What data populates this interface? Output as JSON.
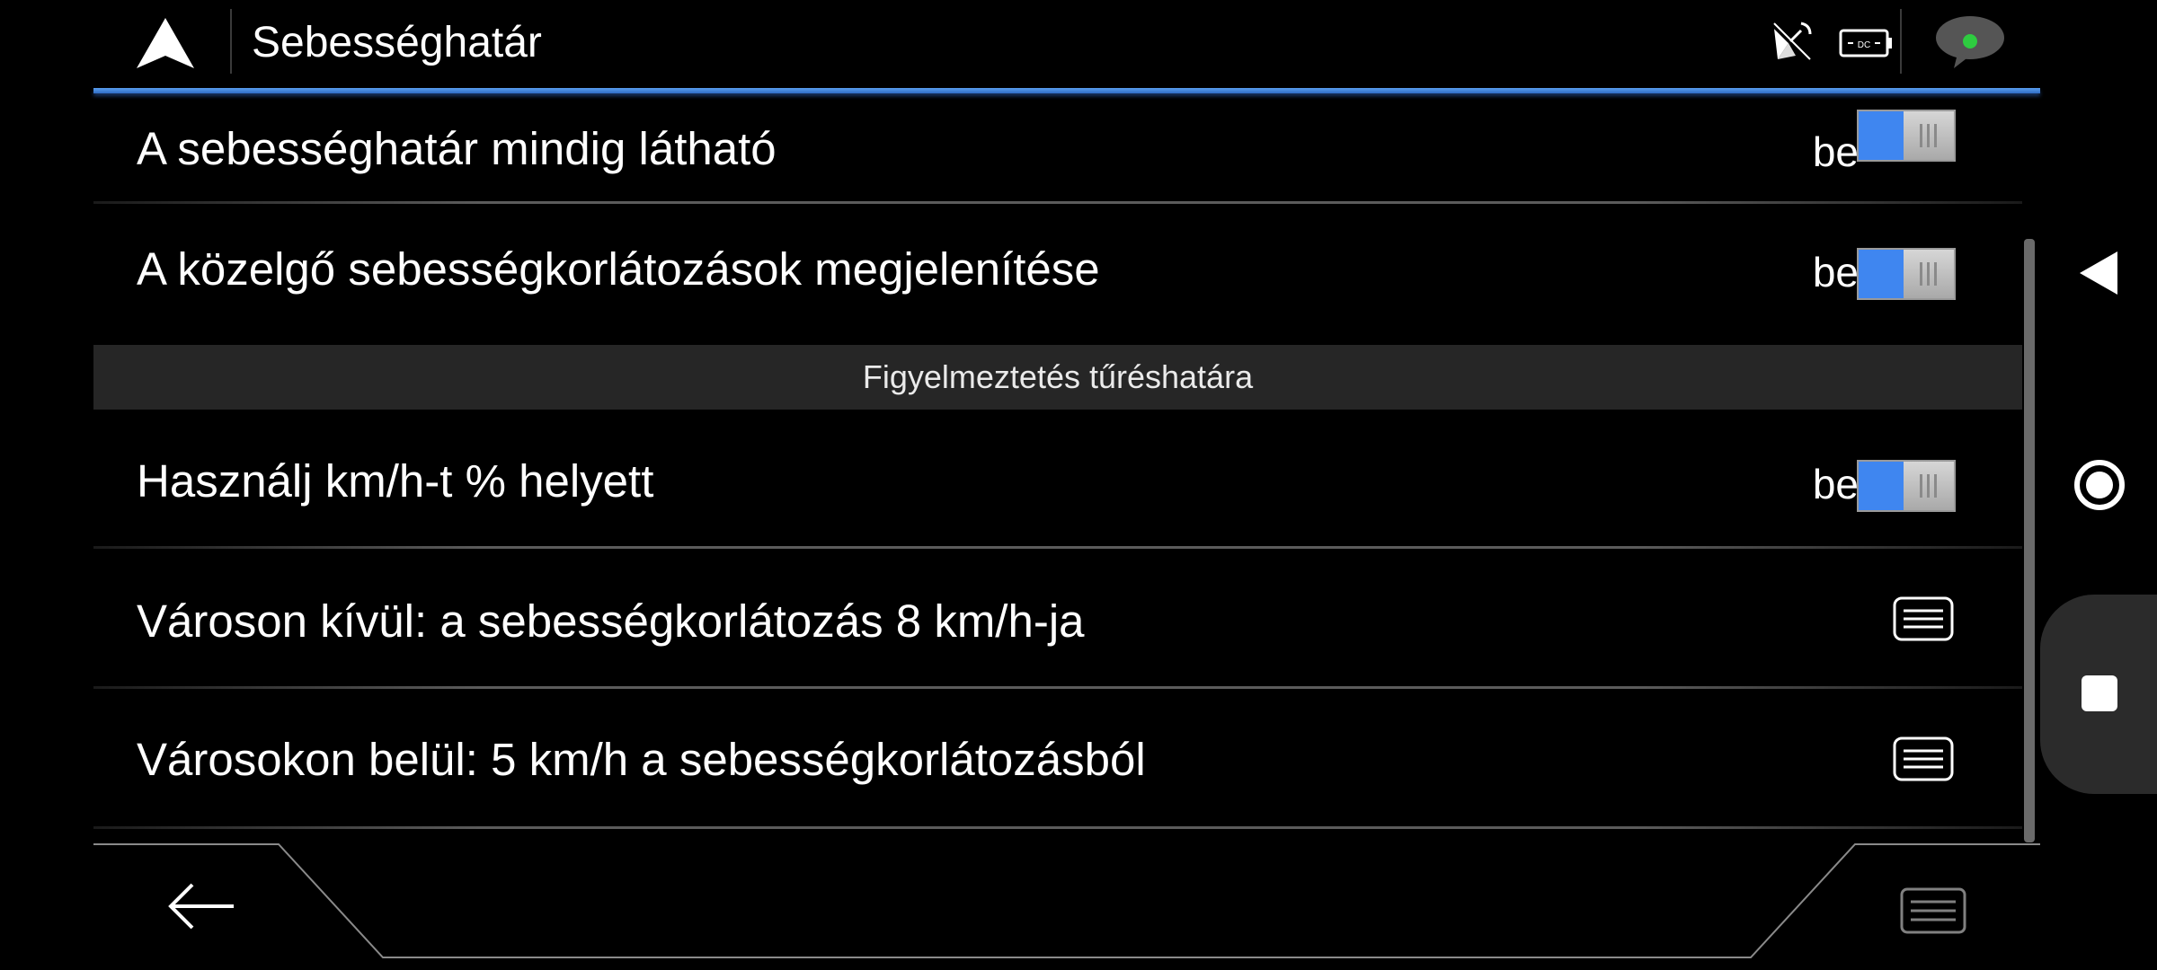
{
  "header": {
    "title": "Sebességhatár"
  },
  "rows": [
    {
      "label": "A sebességhatár mindig látható",
      "state": "be",
      "control": "toggle",
      "on": true
    },
    {
      "label": "A közelgő sebességkorlátozások megjelenítése",
      "state": "be",
      "control": "toggle",
      "on": true
    },
    {
      "label": "Használj km/h-t % helyett",
      "state": "be",
      "control": "toggle",
      "on": true
    },
    {
      "label": "Városon kívül: a sebességkorlátozás 8 km/h-ja",
      "control": "menu"
    },
    {
      "label": "Városokon belül: 5 km/h a sebességkorlátozásból",
      "control": "menu"
    }
  ],
  "section": {
    "label": "Figyelmeztetés tűréshatára"
  },
  "colors": {
    "accent": "#3f86f0",
    "background": "#000000",
    "section_bg": "#262626"
  },
  "icons": [
    "navigation-arrow-icon",
    "satellite-icon",
    "battery-icon",
    "chat-icon",
    "back-arrow-icon",
    "menu-icon"
  ]
}
